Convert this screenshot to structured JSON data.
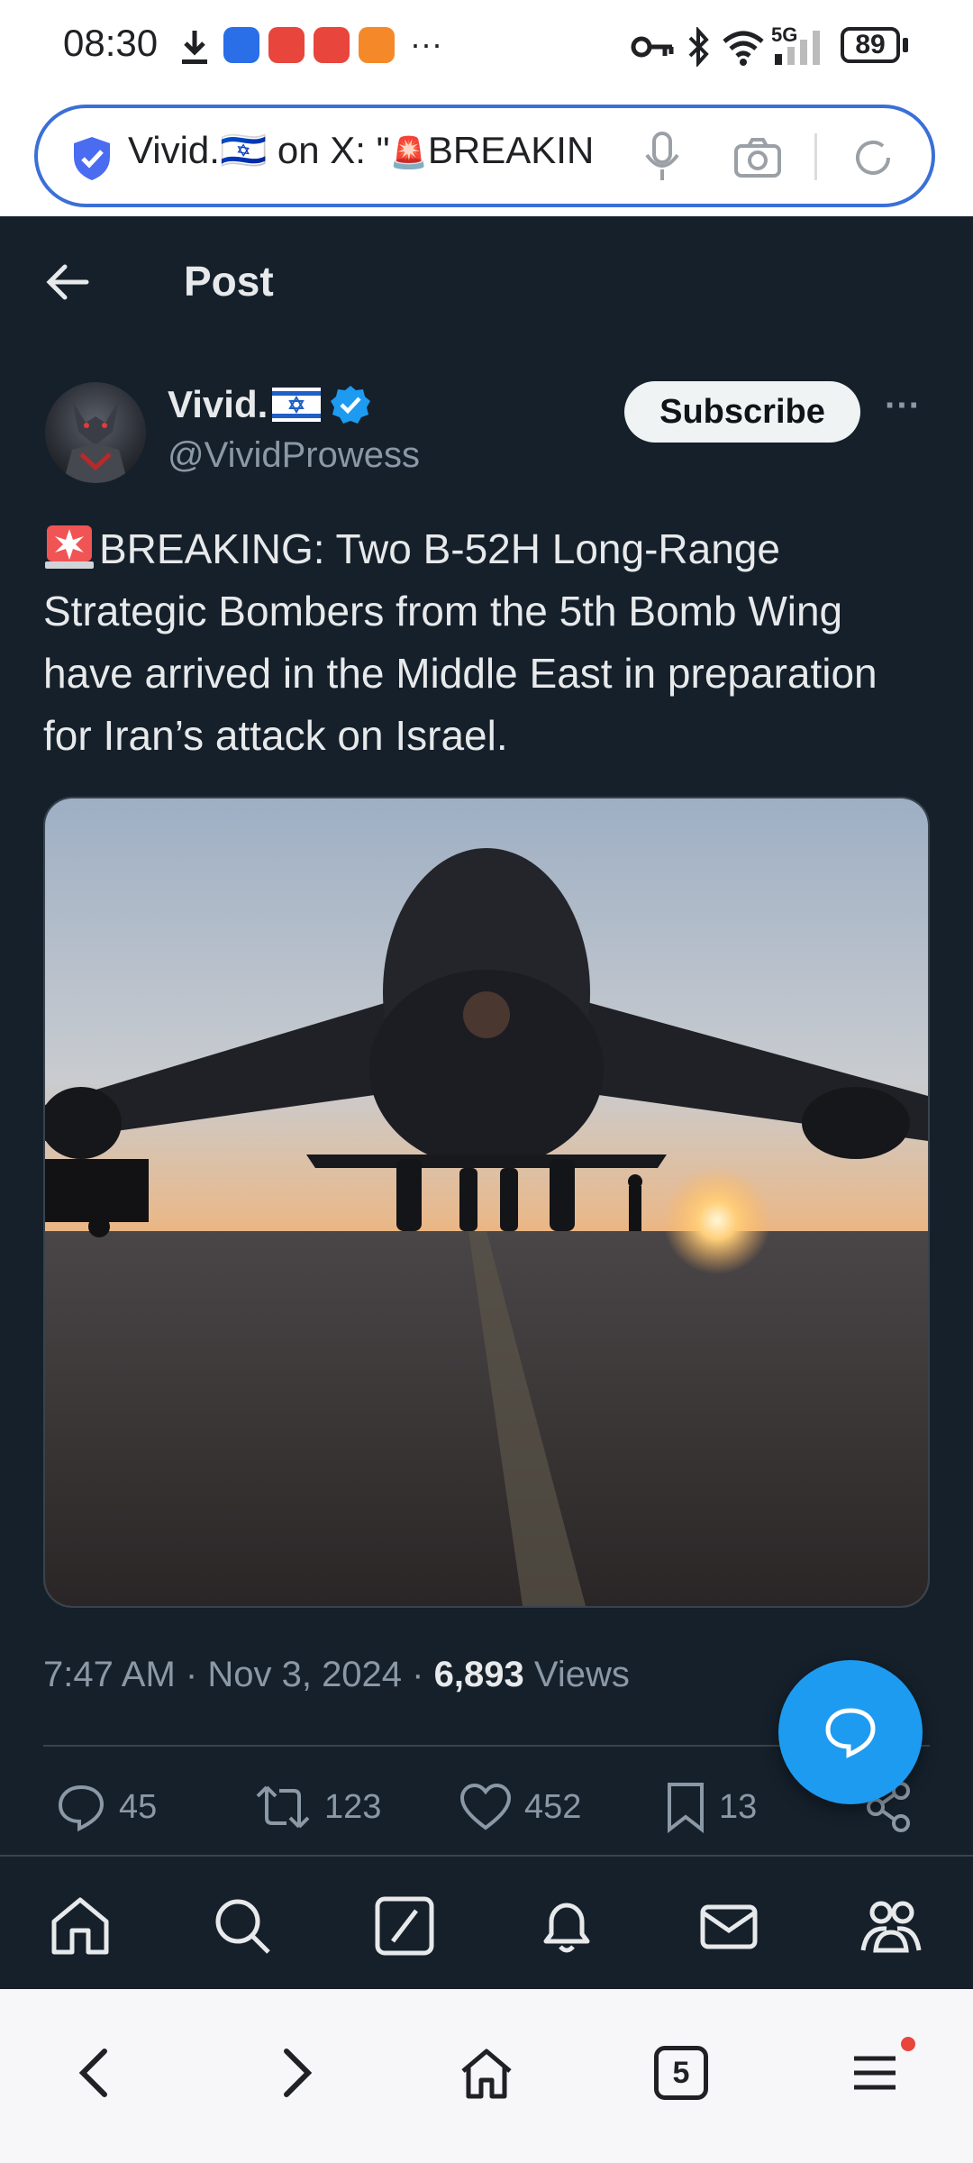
{
  "status_bar": {
    "time": "08:30",
    "network": "5G",
    "battery": "89",
    "overflow": "···"
  },
  "browser": {
    "url_display_prefix": "Vivid.🇮🇱 on X: \"",
    "url_display_suffix": "BREAKIN",
    "tab_count": "5",
    "icons": [
      "shield-icon",
      "mic-icon",
      "camera-icon",
      "reload-icon"
    ]
  },
  "header": {
    "back_label": "←",
    "title": "Post"
  },
  "author": {
    "name": "Vivid.",
    "handle": "@VividProwess",
    "subscribe_label": "Subscribe",
    "more_label": "···"
  },
  "tweet": {
    "text": "BREAKING: Two B-52H Long-Range Strategic Bombers from the 5th Bomb Wing have arrived in the Middle East in preparation for Iran’s attack on Israel.",
    "time": "7:47 AM",
    "date": "Nov 3, 2024",
    "views_count": "6,893",
    "views_label": "Views",
    "sep": "·"
  },
  "actions": {
    "replies": "45",
    "reposts": "123",
    "likes": "452",
    "bookmarks": "13"
  },
  "colors": {
    "background": "#15202b",
    "accent": "#1d9bf0",
    "text": "#e7e9ea",
    "muted": "#8b98a5"
  }
}
